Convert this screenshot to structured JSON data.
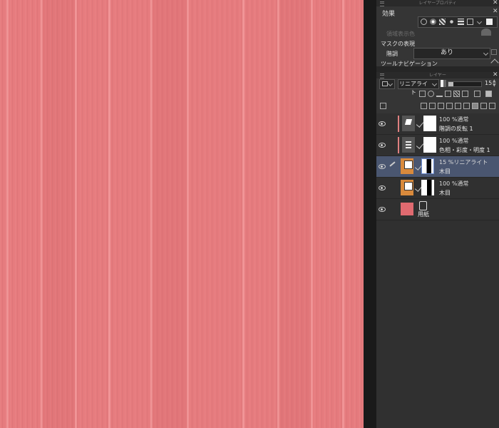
{
  "layer_properties": {
    "title": "レイヤープロパティ",
    "effect_label": "効果",
    "area_color_label": "領域表示色",
    "mask_section_label": "マスクの表現",
    "gradation_label": "階調",
    "gradation_value": "あり",
    "tool_nav_label": "ツールナビゲーション"
  },
  "layer_panel": {
    "title": "レイヤー",
    "blend_mode": "リニアライト",
    "opacity": "15",
    "opacity_fraction": 0.15
  },
  "layers": [
    {
      "mode": "100 %通常",
      "name": "階調の反転 1",
      "type": "correction",
      "icon": "invert-correction-icon",
      "selected": false
    },
    {
      "mode": "100 %通常",
      "name": "色相・彩度・明度 1",
      "type": "correction",
      "icon": "hsl-correction-icon",
      "selected": false
    },
    {
      "mode": "15 %リニアライト",
      "name": "木目",
      "type": "raster",
      "icon": "wood-grain-thumbnail",
      "selected": true
    },
    {
      "mode": "100 %通常",
      "name": "木目",
      "type": "raster",
      "icon": "wood-grain-thumbnail",
      "selected": false
    },
    {
      "mode": "",
      "name": "用紙",
      "type": "paper",
      "icon": "paper-icon",
      "selected": false
    }
  ],
  "colors": {
    "canvas": "#e67b7e",
    "paper_swatch": "#e06a70",
    "selected_layer": "#4a5670",
    "wood_thumb": "#d98a3c"
  }
}
